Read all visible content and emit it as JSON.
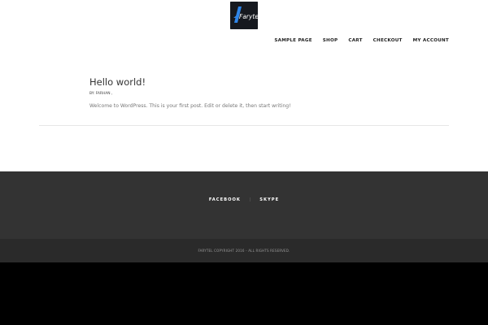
{
  "site": {
    "logo_icon": "farytel-logo-icon",
    "logo_text": "Farytel"
  },
  "nav": {
    "items": [
      {
        "label": "SAMPLE PAGE"
      },
      {
        "label": "SHOP"
      },
      {
        "label": "CART"
      },
      {
        "label": "CHECKOUT"
      },
      {
        "label": "MY ACCOUNT"
      }
    ]
  },
  "post": {
    "title": "Hello world!",
    "meta": "BY: FARHAN ,",
    "excerpt": "Welcome to WordPress. This is your first post. Edit or delete it, then start writing!"
  },
  "footer": {
    "social": [
      {
        "label": "FACEBOOK"
      },
      {
        "label": "SKYPE"
      }
    ],
    "separator": "|",
    "copyright": "FARYTEL COPYRIGHT 2016 - ALL RIGHTS RESERVED."
  },
  "colors": {
    "header_bg": "#ffffff",
    "footer_top_bg": "#333333",
    "footer_bottom_bg": "#2a2a2a",
    "page_bottom_bg": "#000000",
    "logo_accent": "#2f86ea"
  }
}
